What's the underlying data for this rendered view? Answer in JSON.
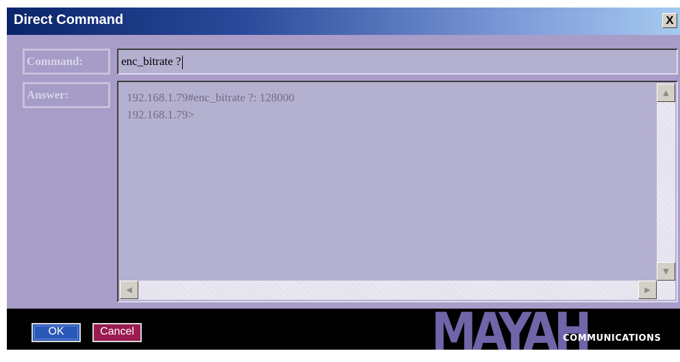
{
  "window": {
    "title": "Direct Command",
    "close_label": "X"
  },
  "command": {
    "label": "Command:",
    "value": "enc_bitrate ?"
  },
  "answer": {
    "label": "Answer:",
    "lines": [
      "192.168.1.79#enc_bitrate ?: 128000",
      "192.168.1.79>"
    ]
  },
  "buttons": {
    "ok_label": "OK",
    "cancel_label": "Cancel"
  },
  "brand": {
    "logo": "MAYAH",
    "tagline": "COMMUNICATIONS"
  },
  "colors": {
    "title_bar": "#0a246a",
    "panel": "#a89cc8",
    "field": "#b4b0d0",
    "ok_button": "#2a58b8",
    "cancel_button": "#9a1c50",
    "footer": "#000000"
  },
  "icons": {
    "scroll_up": "triangle-up",
    "scroll_down": "triangle-down",
    "scroll_left": "triangle-left",
    "scroll_right": "triangle-right"
  }
}
